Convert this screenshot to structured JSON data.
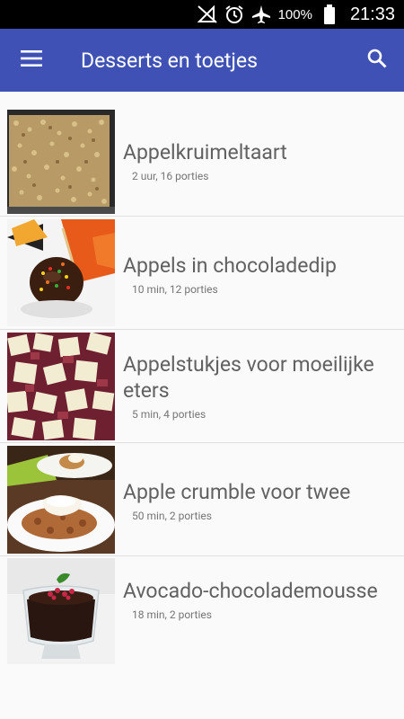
{
  "status": {
    "battery": "100%",
    "time": "21:33",
    "icons": [
      "no-signal-icon",
      "alarm-icon",
      "airplane-mode-icon",
      "battery-icon"
    ]
  },
  "app_bar": {
    "title": "Desserts en toetjes",
    "menu_icon": "menu-icon",
    "search_icon": "search-icon"
  },
  "recipes": [
    {
      "title": "Appelkruimeltaart",
      "meta": "2 uur, 16 porties"
    },
    {
      "title": "Appels in chocoladedip",
      "meta": "10 min, 12 porties"
    },
    {
      "title": "Appelstukjes voor moeilijke eters",
      "meta": "5 min, 4 porties"
    },
    {
      "title": "Apple crumble voor twee",
      "meta": "50 min, 2 porties"
    },
    {
      "title": "Avocado-chocolademousse",
      "meta": "18 min, 2 porties"
    }
  ],
  "colors": {
    "primary": "#3f51b5",
    "status_bar": "#000000",
    "background": "#fafafa",
    "title_text": "#616161"
  }
}
